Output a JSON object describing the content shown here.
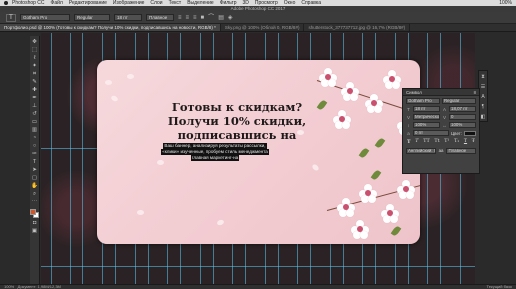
{
  "menubar": {
    "app_name": "Photoshop CC",
    "items": [
      "Файл",
      "Редактирование",
      "Изображение",
      "Слои",
      "Текст",
      "Выделение",
      "Фильтр",
      "3D",
      "Просмотр",
      "Окно",
      "Справка"
    ],
    "right_status": "100%"
  },
  "window_title": "Adobe Photoshop CC 2017",
  "options_bar": {
    "tool_glyph": "T",
    "font_family": "Gotham Pro",
    "font_style": "Regular",
    "font_size": "18 пт",
    "antialias": "Плавное"
  },
  "tabs": [
    {
      "label": "Портфолио.psd @ 100% (Готовы к скидкам? Получи 10% скидки, подписавшись на новости, RGB/8) *",
      "active": true
    },
    {
      "label": "Sky.png @ 100% (Облой 0, RGB/8#)",
      "active": false
    },
    {
      "label": "shutterstock_377737712.jpg @ 16,7% (RGB/8#)",
      "active": false
    }
  ],
  "canvas": {
    "headline_lines": [
      "Готовы к скидкам?",
      "Получи 10% скидки,",
      "подписавшись на новости"
    ],
    "selected_lines": [
      "Ваш баннер, анализируя результаты рассылки,",
      "«клики» изученные, пробуем стиль менеджмента",
      "главная маркетинг-на"
    ]
  },
  "character_panel": {
    "title": "Символ",
    "font_family": "Gotham Pro",
    "font_style": "Regular",
    "size": "18 пт",
    "leading": "18,07 пт",
    "kerning": "Метрическое",
    "tracking": "0",
    "vscale": "100%",
    "hscale": "100%",
    "baseline": "0 пт",
    "color_label": "Цвет:",
    "style_buttons": [
      "T",
      "T",
      "TT",
      "Tt",
      "T¹",
      "T₁",
      "T",
      "Ŧ"
    ],
    "language": "Английский: США",
    "aa_label": "aa",
    "antialias": "Плавное"
  },
  "statusbar": {
    "zoom": "100%",
    "info": "Документ: 1,98M/12,3M",
    "right": "Текущий базо"
  },
  "colors": {
    "accent_guides": "#5ac8f0",
    "artboard_pink": "#f3cfd4",
    "selection_bg": "#111111"
  }
}
